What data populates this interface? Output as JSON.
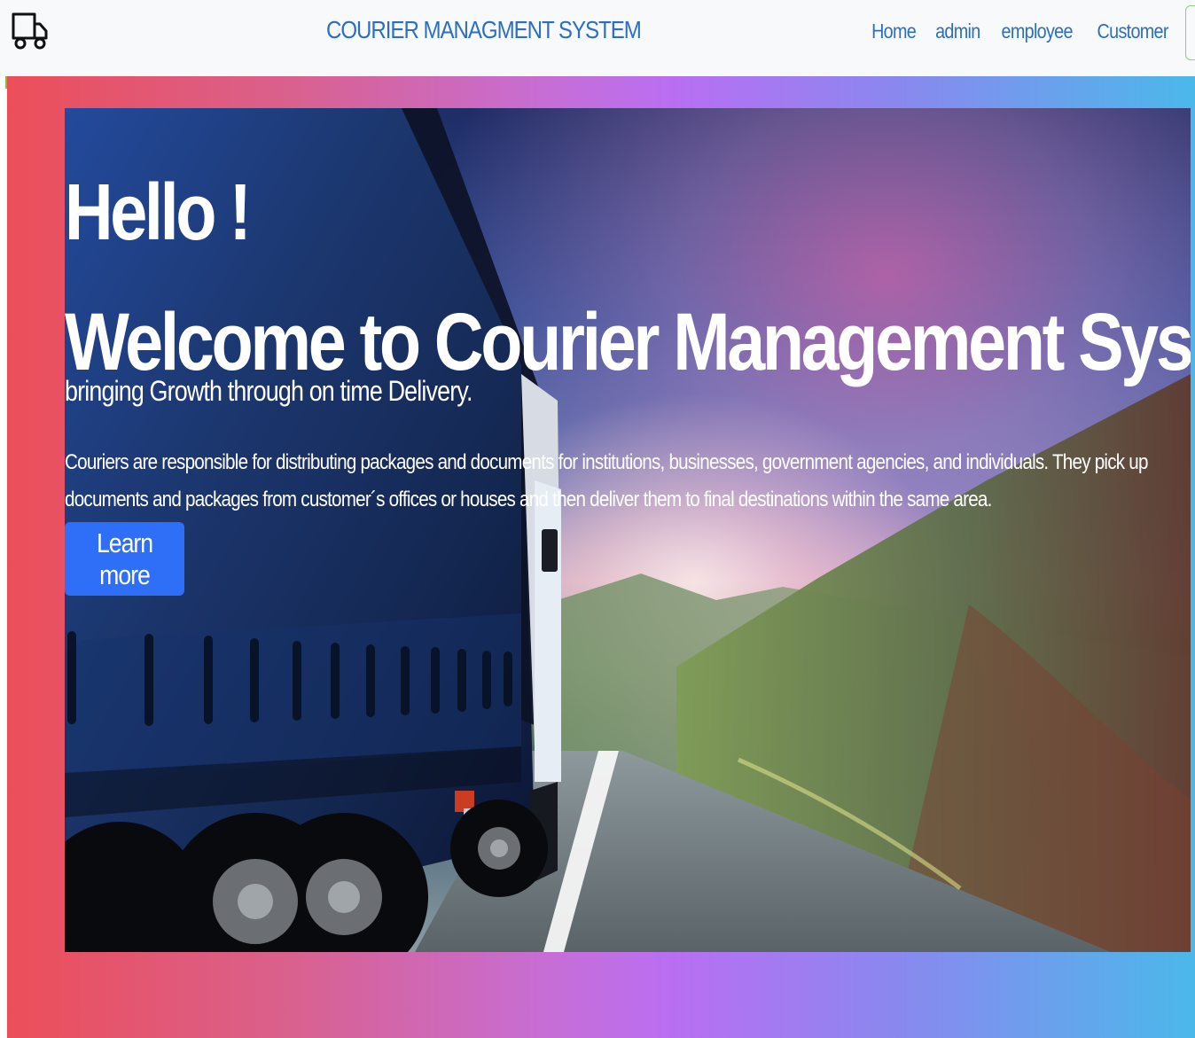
{
  "app": {
    "title": "COURIER MANAGMENT SYSTEM"
  },
  "nav": {
    "items": [
      "Home",
      "admin",
      "employee",
      "Customer"
    ]
  },
  "hero": {
    "hello": "Hello !",
    "welcome": "Welcome to Courier Management System",
    "tagline": "bringing Growth through on time Delivery.",
    "description": "Couriers are responsible for distributing packages and documents for institutions, businesses, government agencies, and individuals. They pick up documents and packages from customer´s offices or houses and then deliver them to final destinations within the same area.",
    "button_label": "Learn more"
  },
  "colors": {
    "nav_text": "#2c6fc2",
    "button": "#2f6ff7",
    "gradient_start": "#ec4e59",
    "gradient_mid": "#b96ef2",
    "gradient_end": "#4bb8ea"
  },
  "icons": {
    "brand": "truck-icon"
  }
}
